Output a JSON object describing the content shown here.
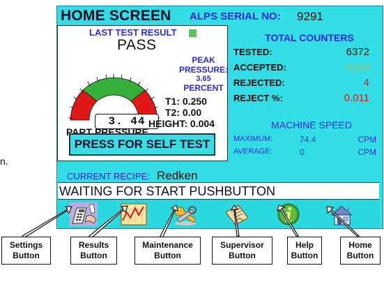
{
  "margin_text": "n.",
  "screen": {
    "title": "HOME SCREEN",
    "serial_label": "ALPS SERIAL NO:",
    "serial_value": "9291"
  },
  "last_test": {
    "label": "LAST TEST RESULT",
    "indicator_color": "#5cc25b",
    "result": "PASS",
    "gauge_value": "3. 44",
    "part_pressure_label": "PART PRESSURE",
    "peak_title_line1": "PEAK",
    "peak_title_line2": "PRESSURE:",
    "peak_value": "3.65",
    "peak_unit": "PERCENT",
    "t1_label": "T1:",
    "t1_value": "0.250",
    "t2_label": "T2:",
    "t2_value": "0.00",
    "height_label": "HEIGHT:",
    "height_value": "0.004",
    "self_test_label": "PRESS FOR SELF TEST"
  },
  "counters": {
    "title": "TOTAL COUNTERS",
    "tested_label": "TESTED:",
    "tested_value": "6372",
    "accepted_label": "ACCEPTED:",
    "accepted_value": "6368",
    "rejected_label": "REJECTED:",
    "rejected_value": "4",
    "reject_pct_label": "REJECT %:",
    "reject_pct_value": "0.011"
  },
  "speed": {
    "title": "MACHINE SPEED",
    "max_label": "MAXIMUM:",
    "max_value": "74.4",
    "max_unit": "CPM",
    "avg_label": "AVERAGE:",
    "avg_value": "0",
    "avg_unit": "CPM"
  },
  "recipe": {
    "label": "CURRENT RECIPE:",
    "value": "Redken"
  },
  "status": {
    "message": "WAITING FOR START PUSHBUTTON"
  },
  "icon_bar": [
    {
      "icon": "settings-calculator-icon"
    },
    {
      "icon": "results-chart-icon"
    },
    {
      "icon": "maintenance-wrench-icon"
    },
    {
      "icon": "supervisor-clipboard-icon"
    },
    {
      "icon": "help-info-icon"
    },
    {
      "icon": "home-house-icon"
    }
  ],
  "annotations": [
    {
      "line1": "Settings",
      "line2": "Button"
    },
    {
      "line1": "Results",
      "line2": "Button"
    },
    {
      "line1": "Maintenance",
      "line2": "Button"
    },
    {
      "line1": "Supervisor",
      "line2": "Button"
    },
    {
      "line1": "Help",
      "line2": "Button"
    },
    {
      "line1": "Home",
      "line2": "Button"
    }
  ],
  "colors": {
    "screen_bg": "#33dde6",
    "title_blue": "#2a2bd6",
    "pass_green": "#5cc25b",
    "reject_red": "#de1a1a",
    "accepted_green": "#88c67a"
  }
}
